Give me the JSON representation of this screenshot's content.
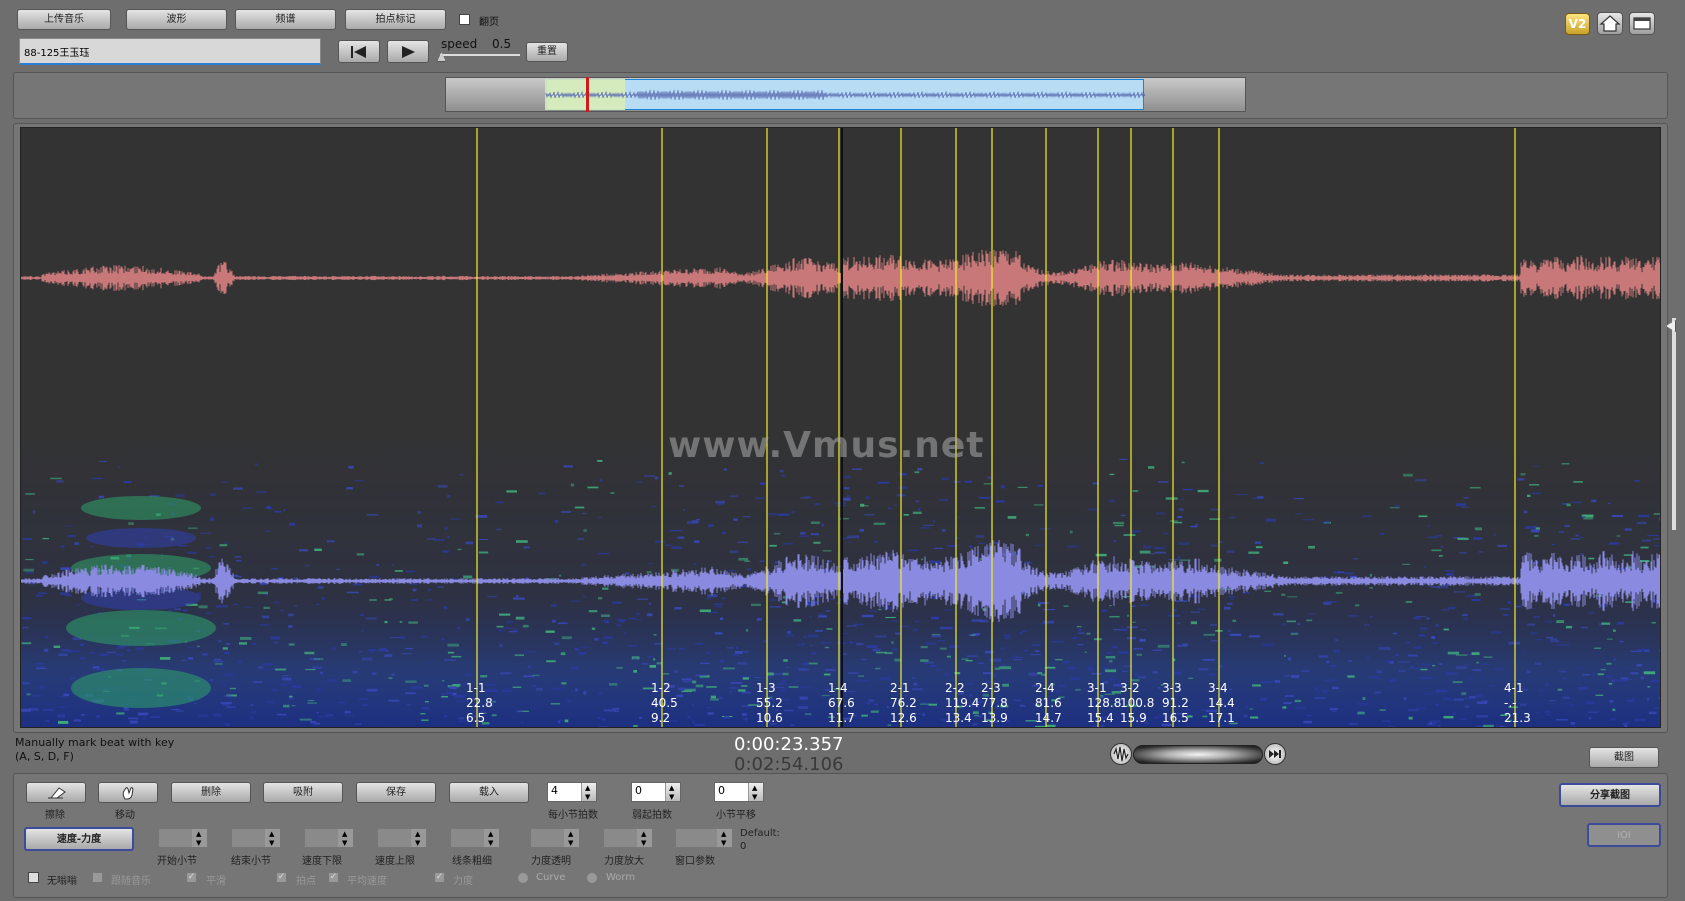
{
  "toolbar": {
    "upload_label": "上传音乐",
    "waveform_label": "波形",
    "spectrum_label": "频谱",
    "beat_mark_label": "拍点标记",
    "page_turn_label": "翻页",
    "track_name": "88-125王玉珏",
    "speed_label": "speed",
    "speed_value": "0.5",
    "reset_label": "重置",
    "version_badge": "V2"
  },
  "watermark": "www.Vmus.net",
  "beats": [
    {
      "label": "1-1",
      "tempo": "22.8",
      "time": "6.5"
    },
    {
      "label": "1-2",
      "tempo": "40.5",
      "time": "9.2"
    },
    {
      "label": "1-3",
      "tempo": "55.2",
      "time": "10.6"
    },
    {
      "label": "1-4",
      "tempo": "67.6",
      "time": "11.7"
    },
    {
      "label": "2-1",
      "tempo": "76.2",
      "time": "12.6"
    },
    {
      "label": "2-2",
      "tempo": "119.4",
      "time": "13.4"
    },
    {
      "label": "2-3",
      "tempo": "77.8",
      "time": "13.9"
    },
    {
      "label": "2-4",
      "tempo": "81.6",
      "time": "14.7"
    },
    {
      "label": "3-1",
      "tempo": "128.8",
      "time": "15.4"
    },
    {
      "label": "3-2",
      "tempo": "100.8",
      "time": "15.9"
    },
    {
      "label": "3-3",
      "tempo": "91.2",
      "time": "16.5"
    },
    {
      "label": "3-4",
      "tempo": "14.4",
      "time": "17.1"
    },
    {
      "label": "4-1",
      "tempo": "-.-",
      "time": "21.3"
    }
  ],
  "status": {
    "hint_line1": "Manually mark beat with key",
    "hint_line2": "(A, S, D, F)",
    "current_time": "0:00:23.357",
    "total_time": "0:02:54.106",
    "screenshot_label": "截图"
  },
  "edit": {
    "erase_label": "擦除",
    "move_label": "移动",
    "delete_label": "删除",
    "snap_label": "吸附",
    "save_label": "保存",
    "load_label": "载入",
    "beats_per_bar_label": "每小节拍数",
    "beats_per_bar_value": "4",
    "pickup_beats_label": "弱起拍数",
    "pickup_beats_value": "0",
    "bar_offset_label": "小节平移",
    "bar_offset_value": "0",
    "share_label": "分享截图",
    "disabled_btn_label": "IOI",
    "tempo_dynamics_label": "速度-力度",
    "start_bar_label": "开始小节",
    "end_bar_label": "结束小节",
    "tempo_lower_label": "速度下限",
    "tempo_upper_label": "速度上限",
    "line_width_label": "线条粗细",
    "dyn_opacity_label": "力度透明",
    "dyn_scale_label": "力度放大",
    "window_param_label": "窗口参数",
    "default_label": "Default:",
    "default_value": "0"
  },
  "options": {
    "no_buzz_label": "无嗡嗡",
    "follow_music_label": "跟随音乐",
    "smooth_label": "平滑",
    "beat_point_label": "拍点",
    "avg_tempo_label": "平均速度",
    "dynamics_label": "力度",
    "curve_label": "Curve",
    "worm_label": "Worm"
  },
  "playback": {
    "viewport_start_fraction": 0.125,
    "viewport_end_fraction": 0.874,
    "playhead_fraction": 0.175
  },
  "colors": {
    "waveform_top": "#c87878",
    "waveform_bottom": "#8a8ae0",
    "beat_line": "#f4f02a",
    "canvas_bg": "#333333"
  }
}
